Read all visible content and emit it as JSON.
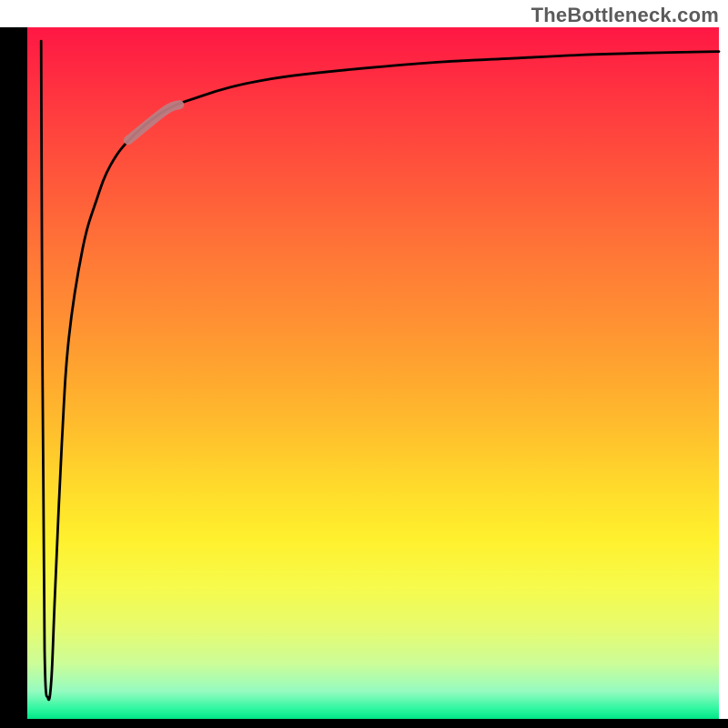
{
  "attribution": "TheBottleneck.com",
  "chart_data": {
    "type": "line",
    "title": "",
    "xlabel": "",
    "ylabel": "",
    "ylim": [
      0,
      100
    ],
    "xlim": [
      0,
      100
    ],
    "series": [
      {
        "name": "curve",
        "x": [
          2.0,
          2.2,
          2.5,
          3.0,
          3.5,
          4,
          5,
          6,
          8,
          10,
          12,
          15,
          20,
          25,
          30,
          35,
          40,
          50,
          60,
          70,
          80,
          90,
          100
        ],
        "values": [
          98,
          50,
          10,
          3,
          6,
          18,
          40,
          55,
          68,
          75,
          80,
          84,
          88,
          90,
          91.5,
          92.5,
          93.2,
          94.2,
          95,
          95.5,
          96,
          96.3,
          96.5
        ]
      }
    ],
    "highlight_segment": {
      "x_start": 15,
      "x_end": 22
    },
    "gradient_stops": [
      {
        "pct": 0,
        "color": "#ff1744"
      },
      {
        "pct": 50,
        "color": "#ffbe2d"
      },
      {
        "pct": 80,
        "color": "#fff02d"
      },
      {
        "pct": 100,
        "color": "#00e686"
      }
    ]
  }
}
